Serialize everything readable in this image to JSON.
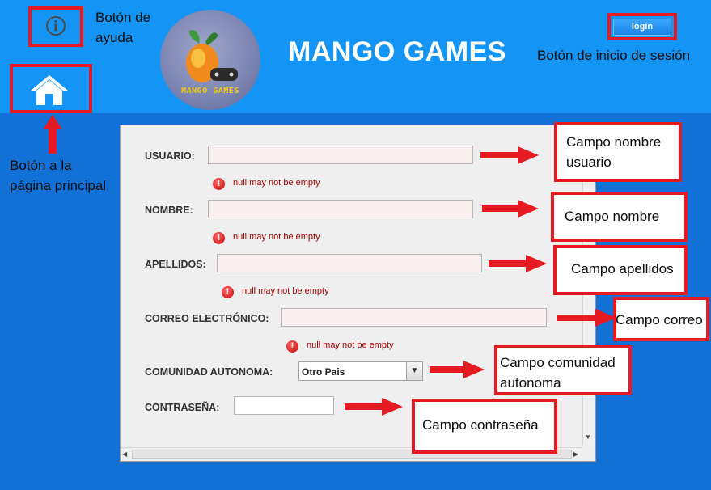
{
  "header": {
    "brand_title": "MANGO GAMES",
    "logo_text": "MANGO GAMES",
    "login_label": "login",
    "help_icon": "info-icon",
    "home_icon": "home-icon"
  },
  "annotations": {
    "help_line1": "Botón de",
    "help_line2": "ayuda",
    "login": "Botón de inicio de sesión",
    "home_line1": "Botón a la",
    "home_line2": "página principal",
    "usuario_line1": "Campo nombre",
    "usuario_line2": "usuario",
    "nombre": "Campo nombre",
    "apellidos": "Campo apellidos",
    "correo": "Campo correo",
    "comunidad_line1": "Campo comunidad",
    "comunidad_line2": "autonoma",
    "contrasena": "Campo contraseña"
  },
  "form": {
    "usuario": {
      "label": "USUARIO:",
      "value": "",
      "error": "null may not be empty"
    },
    "nombre": {
      "label": "NOMBRE:",
      "value": "",
      "error": "null may not be empty"
    },
    "apellidos": {
      "label": "APELLIDOS:",
      "value": "",
      "error": "null may not be empty"
    },
    "correo": {
      "label": "CORREO ELECTRÓNICO:",
      "value": "",
      "error": "null may not be empty"
    },
    "comunidad": {
      "label": "COMUNIDAD AUTONOMA:",
      "selected": "Otro Pais"
    },
    "contrasena": {
      "label": "CONTRASEÑA:",
      "value": ""
    }
  },
  "colors": {
    "header_bg": "#1494f4",
    "page_bg": "#1271d6",
    "annotation_red": "#e51b24",
    "error_text": "#a10000"
  }
}
